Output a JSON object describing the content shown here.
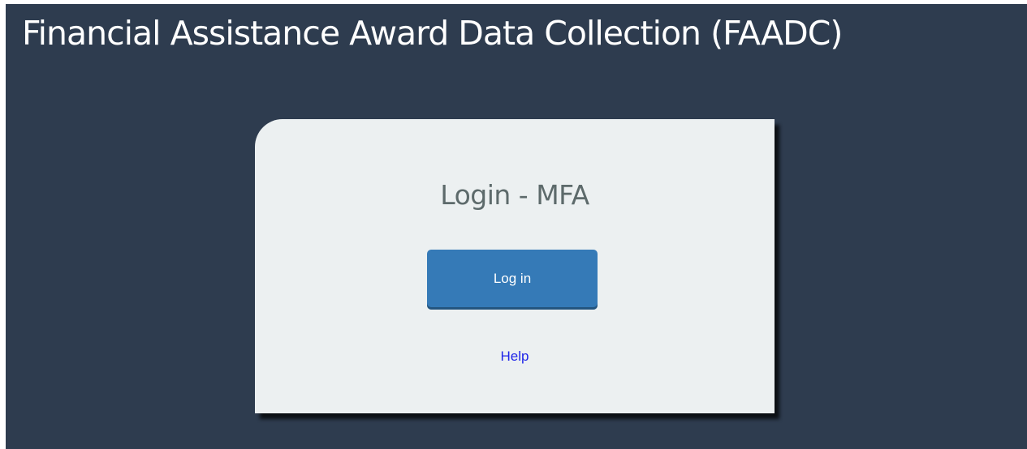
{
  "header": {
    "title": "Financial Assistance Award Data Collection (FAADC)"
  },
  "login_card": {
    "heading": "Login - MFA",
    "login_button_label": "Log in",
    "help_link_label": "Help"
  },
  "colors": {
    "page_background": "#2e3c4f",
    "card_background": "#ecf0f1",
    "button_background": "#357ab7",
    "link_color": "#1f25e8"
  }
}
